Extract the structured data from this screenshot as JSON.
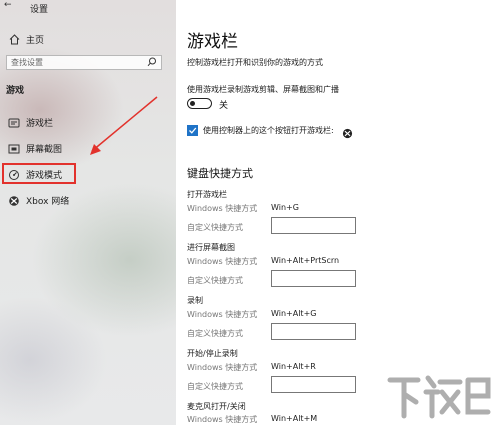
{
  "window": {
    "title": "设置"
  },
  "sidebar": {
    "home_label": "主页",
    "search_placeholder": "查找设置",
    "section_label": "游戏",
    "items": [
      {
        "label": "游戏栏",
        "icon": "gamebar-icon"
      },
      {
        "label": "屏幕截图",
        "icon": "screenshot-icon"
      },
      {
        "label": "游戏模式",
        "icon": "gamemode-icon",
        "highlighted": true
      },
      {
        "label": "Xbox 网络",
        "icon": "xbox-icon"
      }
    ]
  },
  "main": {
    "title": "游戏栏",
    "description": "控制游戏栏打开和识别你的游戏的方式",
    "record_setting_label": "使用游戏栏录制游戏剪辑、屏幕截图和广播",
    "toggle_state_label": "关",
    "toggle_on": false,
    "controller_checkbox_label": "使用控制器上的这个按钮打开游戏栏:",
    "controller_checked": true,
    "shortcuts_title": "键盘快捷方式",
    "windows_shortcut_label": "Windows 快捷方式",
    "custom_shortcut_label": "自定义快捷方式",
    "shortcuts": [
      {
        "name": "打开游戏栏",
        "windows_shortcut": "Win+G",
        "custom_value": ""
      },
      {
        "name": "进行屏幕截图",
        "windows_shortcut": "Win+Alt+PrtScrn",
        "custom_value": ""
      },
      {
        "name": "录制",
        "windows_shortcut": "Win+Alt+G",
        "custom_value": ""
      },
      {
        "name": "开始/停止录制",
        "windows_shortcut": "Win+Alt+R",
        "custom_value": ""
      },
      {
        "name": "麦克风打开/关闭",
        "windows_shortcut": "Win+Alt+M",
        "custom_value": ""
      }
    ]
  },
  "annotation": {
    "color": "#e2322c"
  },
  "watermark": {
    "text": "下载吧"
  },
  "colors": {
    "accent": "#1f73c7",
    "highlight": "#e2322c"
  }
}
